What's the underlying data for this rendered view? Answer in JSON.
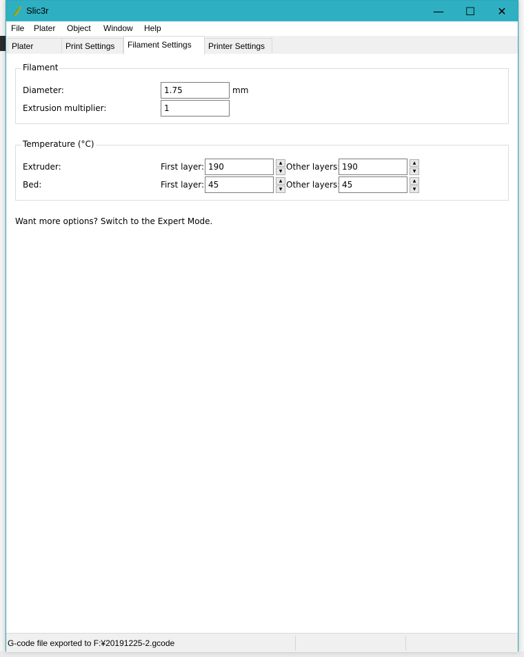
{
  "window": {
    "title": "Slic3r"
  },
  "controls": {
    "minimize": "—",
    "maximize": "☐",
    "close": "✕"
  },
  "menu": [
    "File",
    "Plater",
    "Object",
    "Window",
    "Help"
  ],
  "tabs": [
    {
      "label": "Plater",
      "active": false
    },
    {
      "label": "Print Settings",
      "active": false
    },
    {
      "label": "Filament Settings",
      "active": true
    },
    {
      "label": "Printer Settings",
      "active": false
    }
  ],
  "filament": {
    "title": "Filament",
    "diameter_label": "Diameter:",
    "diameter_value": "1.75",
    "diameter_unit": "mm",
    "extrusion_label": "Extrusion multiplier:",
    "extrusion_value": "1"
  },
  "temperature": {
    "title": "Temperature (°C)",
    "extruder_label": "Extruder:",
    "bed_label": "Bed:",
    "first_layer_label": "First layer:",
    "other_layers_label": "Other layers:",
    "extruder_first": "190",
    "extruder_other": "190",
    "bed_first": "45",
    "bed_other": "45"
  },
  "expert_hint": "Want more options? Switch to the Expert Mode.",
  "status": {
    "message": "G-code file exported to F:¥20191225-2.gcode"
  }
}
